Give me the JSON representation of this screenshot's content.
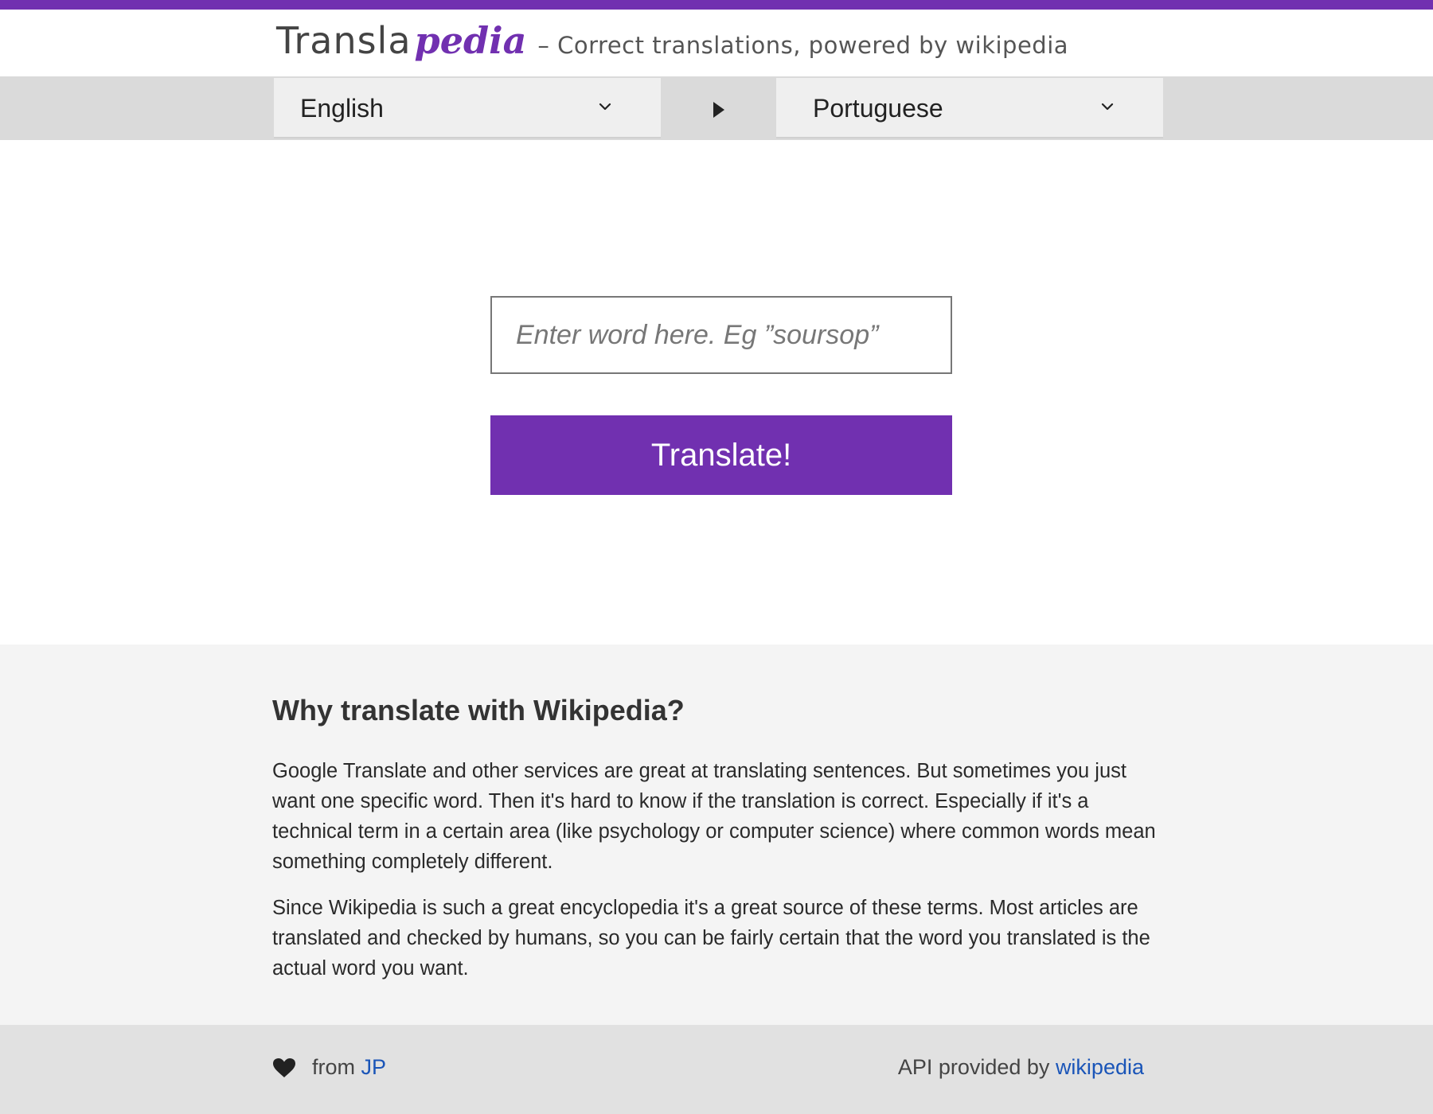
{
  "colors": {
    "brand_purple": "#7130b0",
    "link_blue": "#1a55b8"
  },
  "header": {
    "logo_part1": "Transla",
    "logo_part2": "pedia",
    "tagline": "– Correct translations, powered by wikipedia"
  },
  "language_bar": {
    "source_language": "English",
    "target_language": "Portuguese",
    "dropdown_icon": "chevron-down-icon",
    "swap_icon": "play-arrow-icon"
  },
  "search": {
    "placeholder": "Enter word here. Eg ”soursop”",
    "value": ""
  },
  "translate_button": {
    "label": "Translate!"
  },
  "why_section": {
    "title": "Why translate with Wikipedia?",
    "paragraphs": [
      "Google Translate and other services are great at translating sentences. But sometimes you just want one specific word. Then it's hard to know if the translation is correct. Especially if it's a technical term in a certain area (like psychology or computer science) where common words mean something completely different.",
      "Since Wikipedia is such a great encyclopedia it's a great source of these terms. Most articles are translated and checked by humans, so you can be fairly certain that the word you translated is the actual word you want."
    ]
  },
  "footer": {
    "heart_icon": "heart-icon",
    "from_text": "from",
    "author_link": "JP",
    "api_text": "API provided by",
    "api_link": "wikipedia"
  }
}
